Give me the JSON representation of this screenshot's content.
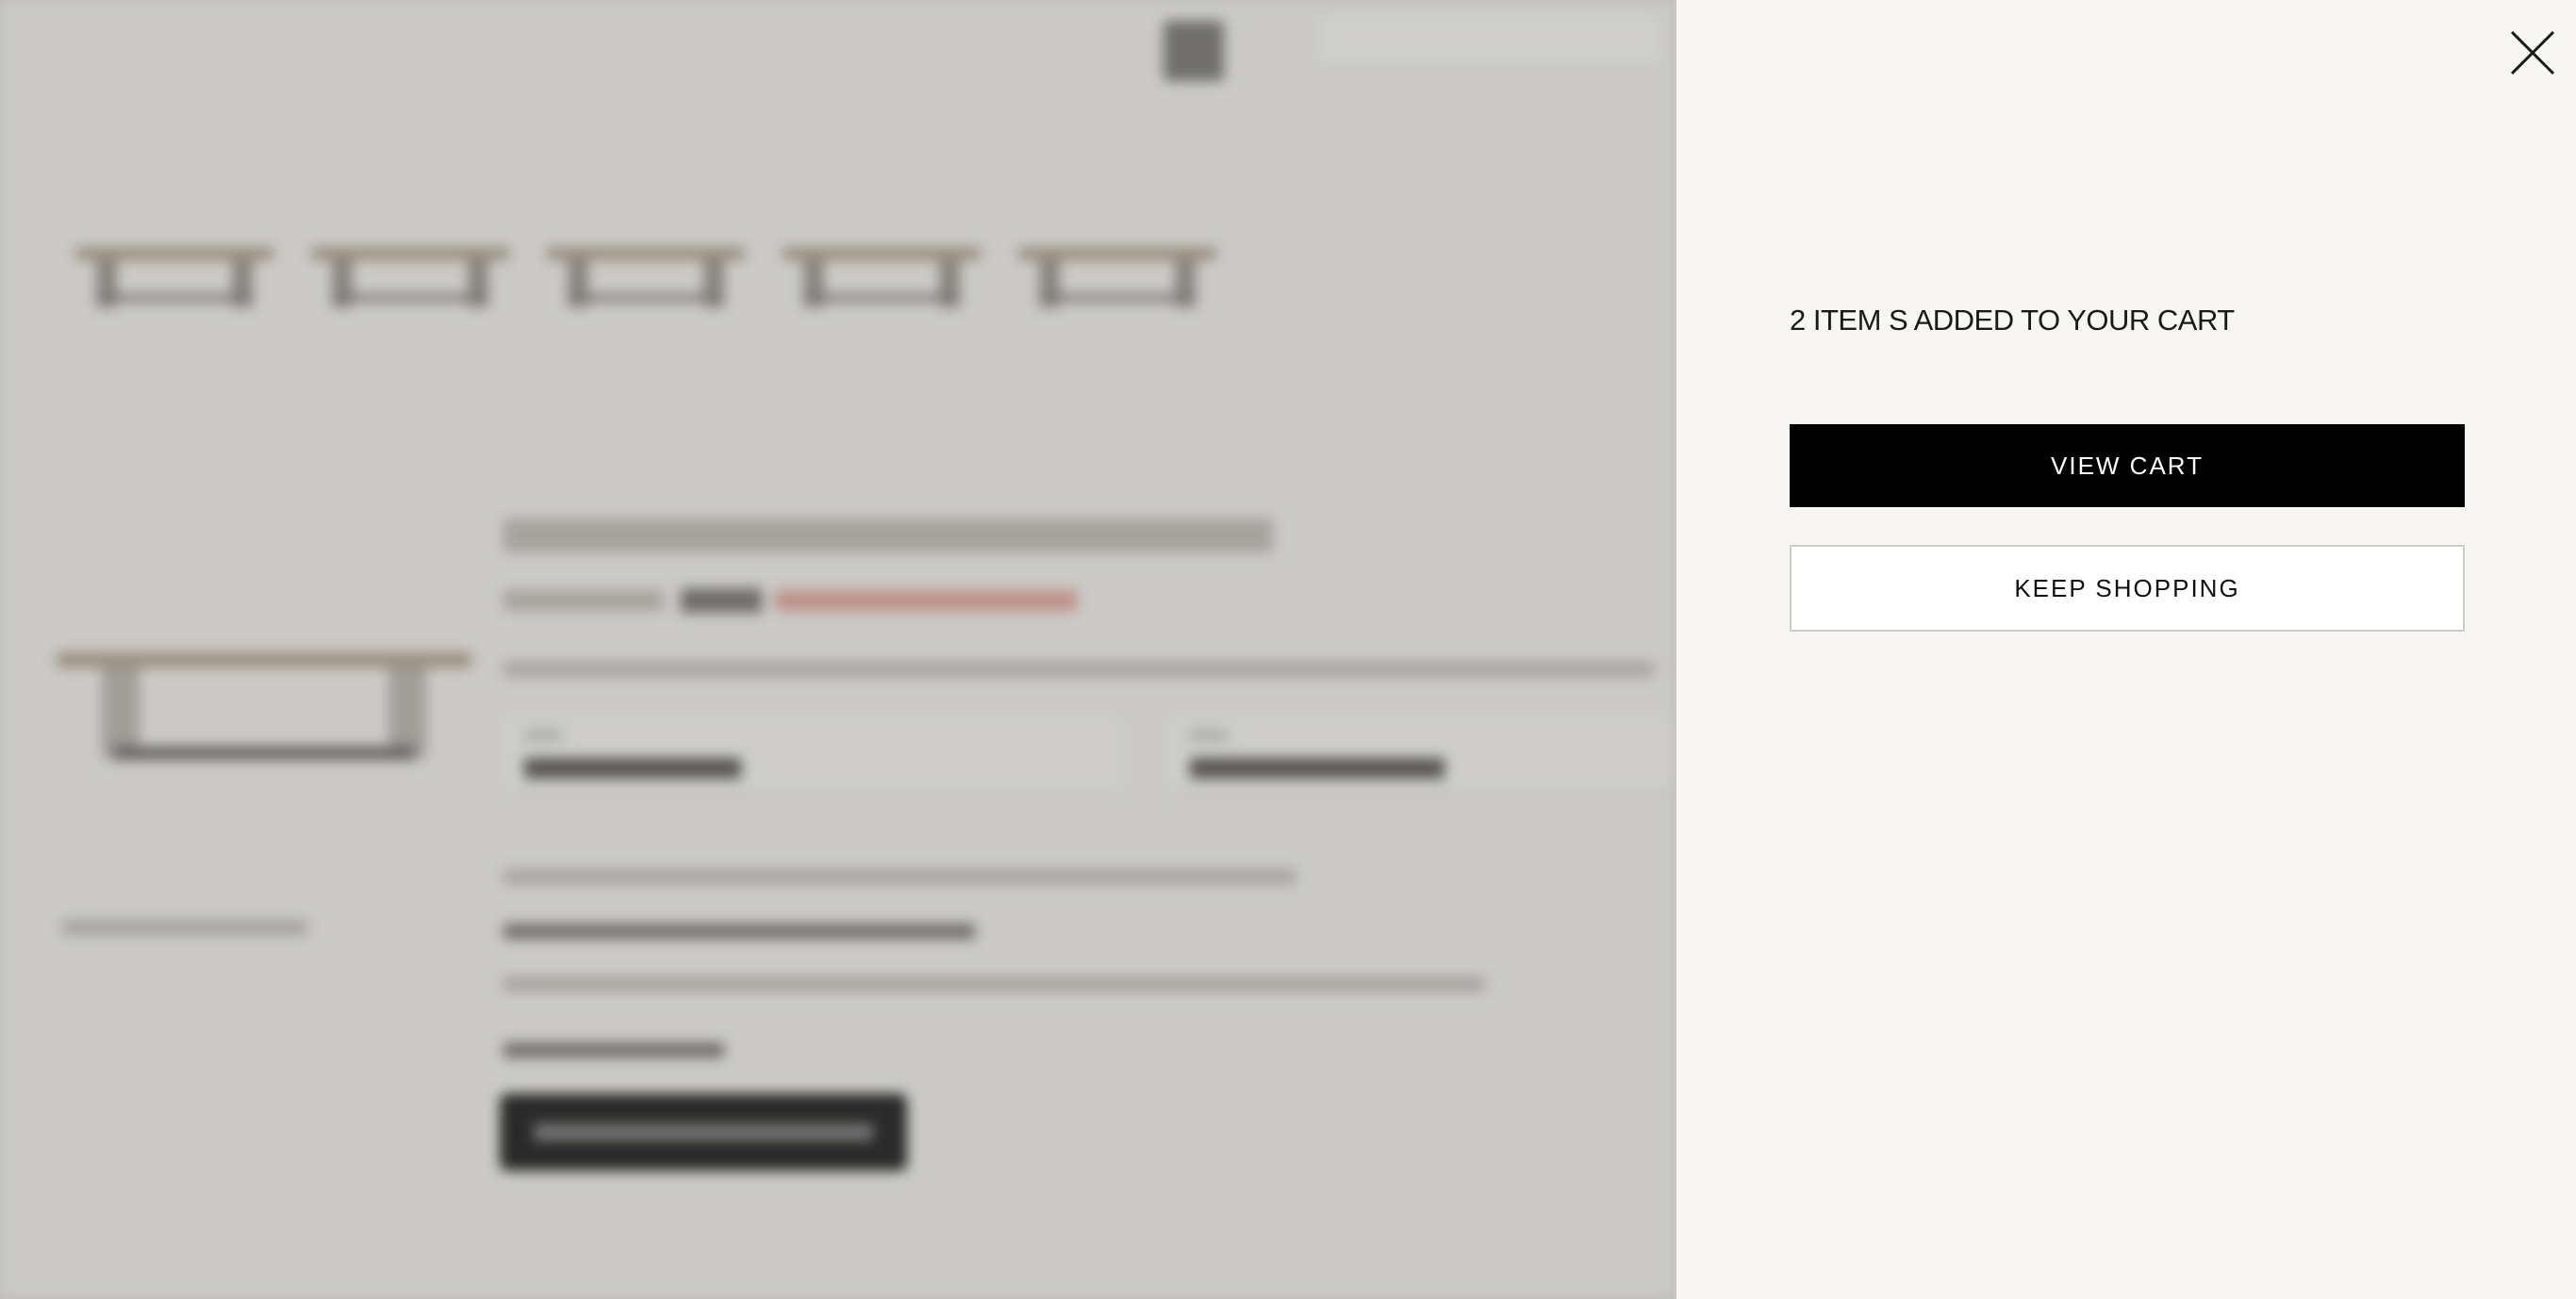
{
  "drawer": {
    "message": "2 ITEM S ADDED TO YOUR CART",
    "view_cart_label": "VIEW CART",
    "keep_shopping_label": "KEEP SHOPPING",
    "close_icon": "close-icon"
  },
  "colors": {
    "drawer_background": "#f7f6f2",
    "primary_button": "#000000",
    "primary_button_text": "#ffffff",
    "secondary_button": "#ffffff",
    "overlay": "#d8d6d3"
  }
}
